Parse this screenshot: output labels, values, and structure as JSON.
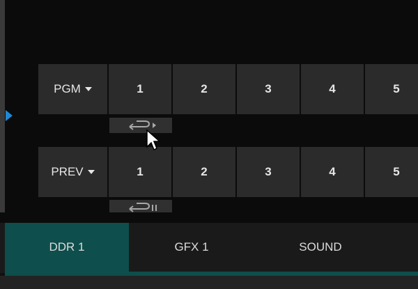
{
  "program_row": {
    "bus_label": "PGM",
    "sources": [
      "1",
      "2",
      "3",
      "4",
      "5"
    ],
    "mode_icon": "loop-play-icon"
  },
  "preview_row": {
    "bus_label": "PREV",
    "sources": [
      "1",
      "2",
      "3",
      "4",
      "5"
    ],
    "mode_icon": "loop-pause-icon"
  },
  "tabs": [
    {
      "label": "DDR 1",
      "active": true
    },
    {
      "label": "GFX 1",
      "active": false
    },
    {
      "label": "SOUND",
      "active": false
    }
  ],
  "colors": {
    "accent": "#0e4e4c",
    "indicator": "#1e88d6",
    "button_bg": "#2b2b2b"
  }
}
